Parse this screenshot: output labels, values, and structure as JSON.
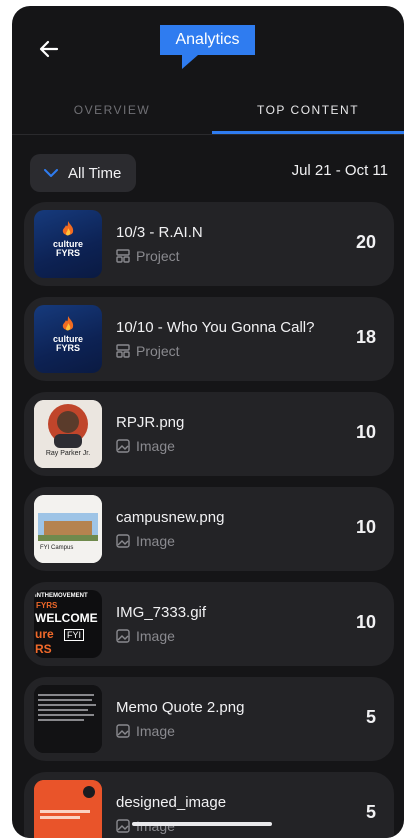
{
  "header": {
    "back_icon": "back-arrow-icon",
    "title": "Analytics"
  },
  "tabs": [
    {
      "label": "OVERVIEW",
      "selected": false
    },
    {
      "label": "TOP CONTENT",
      "selected": true
    }
  ],
  "filter": {
    "label": "All Time",
    "icon": "chevron-down-icon",
    "date_range": "Jul 21 - Oct 11"
  },
  "items": [
    {
      "name": "10/3 - R.AI.N",
      "type": "Project",
      "type_icon": "project-icon",
      "count": "20",
      "thumb": "culture FYRS graphic"
    },
    {
      "name": "10/10 - Who You Gonna Call?",
      "type": "Project",
      "type_icon": "project-icon",
      "count": "18",
      "thumb": "culture FYRS graphic"
    },
    {
      "name": "RPJR.png",
      "type": "Image",
      "type_icon": "image-icon",
      "count": "10",
      "thumb": "portrait"
    },
    {
      "name": "campusnew.png",
      "type": "Image",
      "type_icon": "image-icon",
      "count": "10",
      "thumb": "campus photo"
    },
    {
      "name": "IMG_7333.gif",
      "type": "Image",
      "type_icon": "image-icon",
      "count": "10",
      "thumb": "welcome graphic"
    },
    {
      "name": "Memo Quote 2.png",
      "type": "Image",
      "type_icon": "image-icon",
      "count": "5",
      "thumb": "text memo"
    },
    {
      "name": "designed_image",
      "type": "Image",
      "type_icon": "image-icon",
      "count": "5",
      "thumb": "orange graphic"
    }
  ],
  "thumb_text": {
    "culture": "culture",
    "fyrs": "FYRS",
    "ray_name": "Ray Parker Jr.",
    "campus_caption": "FYI Campus",
    "welcome": "WELCOME",
    "welcome_fyi": "FYI",
    "movement": "INTHEMOVEMENT",
    "ure": "ure",
    "rs": "RS"
  },
  "colors": {
    "accent": "#2f7cf0",
    "background": "#151517",
    "card": "#232326",
    "muted_text": "#8a8a8f"
  }
}
